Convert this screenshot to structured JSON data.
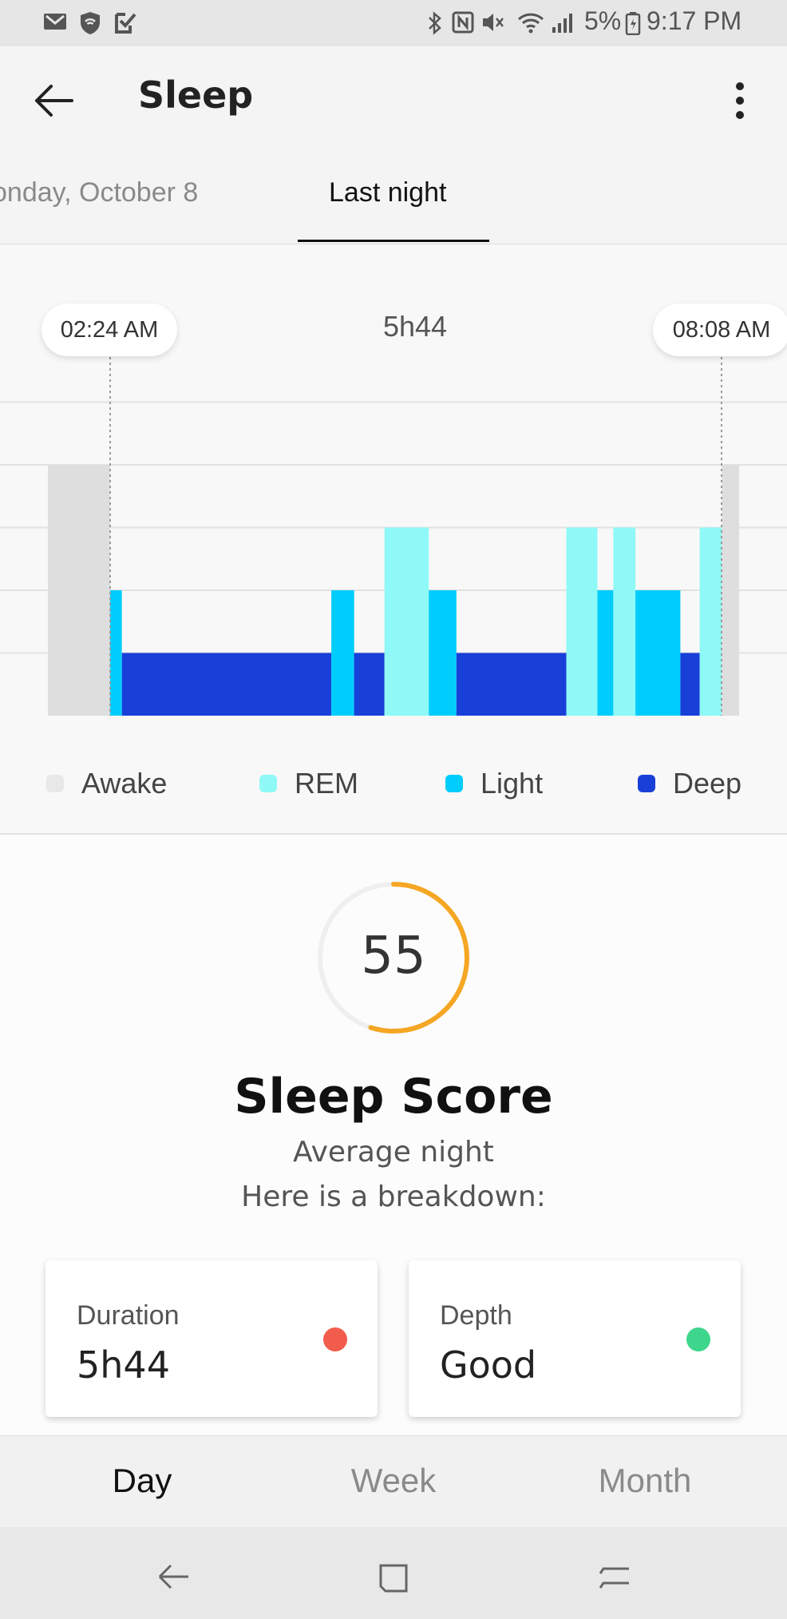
{
  "status_bar": {
    "left_icons": [
      "gmail-icon",
      "shield-icon",
      "checklist-icon"
    ],
    "right_icons": [
      "bluetooth-icon",
      "nfc-icon",
      "mute-icon",
      "wifi-icon",
      "signal-icon",
      "battery-icon"
    ],
    "battery_percent": "5%",
    "time": "9:17 PM"
  },
  "app_bar": {
    "title": "Sleep",
    "back_icon": "back-arrow-icon",
    "menu_icon": "more-vert-icon"
  },
  "date_tabs": {
    "previous": "onday, October 8",
    "current": "Last night"
  },
  "sleep_chart": {
    "start_time": "02:24 AM",
    "end_time": "08:08 AM",
    "total_duration": "5h44",
    "colors": {
      "awake": "#dedede",
      "rem": "#8ef9f6",
      "light": "#00cdfb",
      "deep": "#1840d8"
    },
    "legend": [
      {
        "label": "Awake",
        "color": "#e8e8e8"
      },
      {
        "label": "REM",
        "color": "#8ef9f6"
      },
      {
        "label": "Light",
        "color": "#00cdfb"
      },
      {
        "label": "Deep",
        "color": "#1840d8"
      }
    ]
  },
  "chart_data": {
    "type": "bar",
    "stages": [
      "Awake",
      "REM",
      "Light",
      "Deep"
    ],
    "segments": [
      {
        "stage": "Awake",
        "start": 0.0,
        "end": 0.09
      },
      {
        "stage": "Light",
        "start": 0.09,
        "end": 0.107
      },
      {
        "stage": "Deep",
        "start": 0.107,
        "end": 0.41
      },
      {
        "stage": "Light",
        "start": 0.41,
        "end": 0.443
      },
      {
        "stage": "Deep",
        "start": 0.443,
        "end": 0.487
      },
      {
        "stage": "REM",
        "start": 0.487,
        "end": 0.551
      },
      {
        "stage": "Light",
        "start": 0.551,
        "end": 0.591
      },
      {
        "stage": "Deep",
        "start": 0.591,
        "end": 0.75
      },
      {
        "stage": "REM",
        "start": 0.75,
        "end": 0.795
      },
      {
        "stage": "Light",
        "start": 0.795,
        "end": 0.818
      },
      {
        "stage": "REM",
        "start": 0.818,
        "end": 0.85
      },
      {
        "stage": "Light",
        "start": 0.85,
        "end": 0.915
      },
      {
        "stage": "Deep",
        "start": 0.915,
        "end": 0.943
      },
      {
        "stage": "REM",
        "start": 0.943,
        "end": 0.975
      },
      {
        "stage": "Awake",
        "start": 0.975,
        "end": 1.0
      }
    ],
    "x_start_label": "02:24 AM",
    "x_end_label": "08:08 AM",
    "total_label": "5h44",
    "grid": true,
    "legend_position": "bottom"
  },
  "score": {
    "value": "55",
    "fraction": 0.55,
    "ring_color": "#f5a623",
    "title": "Sleep Score",
    "subtitle": "Average night",
    "subtitle2": "Here is a breakdown:"
  },
  "cards": [
    {
      "label": "Duration",
      "value": "5h44",
      "status_color": "#f25c4c"
    },
    {
      "label": "Depth",
      "value": "Good",
      "status_color": "#3dd68c"
    }
  ],
  "bottom_tabs": [
    {
      "label": "Day",
      "selected": true
    },
    {
      "label": "Week",
      "selected": false
    },
    {
      "label": "Month",
      "selected": false
    }
  ],
  "nav_bar": {
    "icons": [
      "nav-back-icon",
      "nav-home-icon",
      "nav-recents-icon"
    ]
  }
}
